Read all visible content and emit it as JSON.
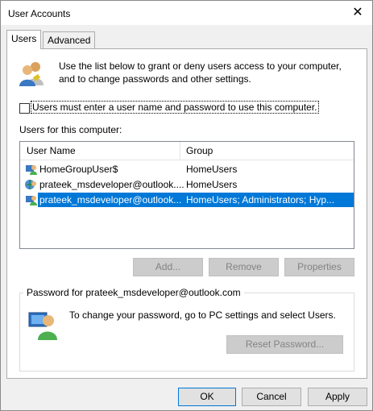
{
  "window": {
    "title": "User Accounts"
  },
  "tabs": [
    {
      "label": "Users"
    },
    {
      "label": "Advanced"
    }
  ],
  "intro_text": "Use the list below to grant or deny users access to your computer, and to change passwords and other settings.",
  "must_login_checkbox": {
    "label": "Users must enter a user name and password to use this computer.",
    "checked": false
  },
  "users_list": {
    "caption": "Users for this computer:",
    "columns": [
      "User Name",
      "Group"
    ],
    "rows": [
      {
        "name": "HomeGroupUser$",
        "group": "HomeUsers",
        "selected": false
      },
      {
        "name": "prateek_msdeveloper@outlook....",
        "group": "HomeUsers",
        "selected": false
      },
      {
        "name": "prateek_msdeveloper@outlook....",
        "group": "HomeUsers; Administrators; Hyp...",
        "selected": true
      }
    ]
  },
  "list_buttons": {
    "add": "Add...",
    "remove": "Remove",
    "properties": "Properties"
  },
  "password_group": {
    "title": "Password for prateek_msdeveloper@outlook.com",
    "text": "To change your password, go to PC settings and select Users.",
    "reset_button": "Reset Password..."
  },
  "footer_buttons": {
    "ok": "OK",
    "cancel": "Cancel",
    "apply": "Apply"
  },
  "colors": {
    "selection": "#0078d7",
    "panel": "#ffffff",
    "chrome": "#f0f0f0"
  }
}
